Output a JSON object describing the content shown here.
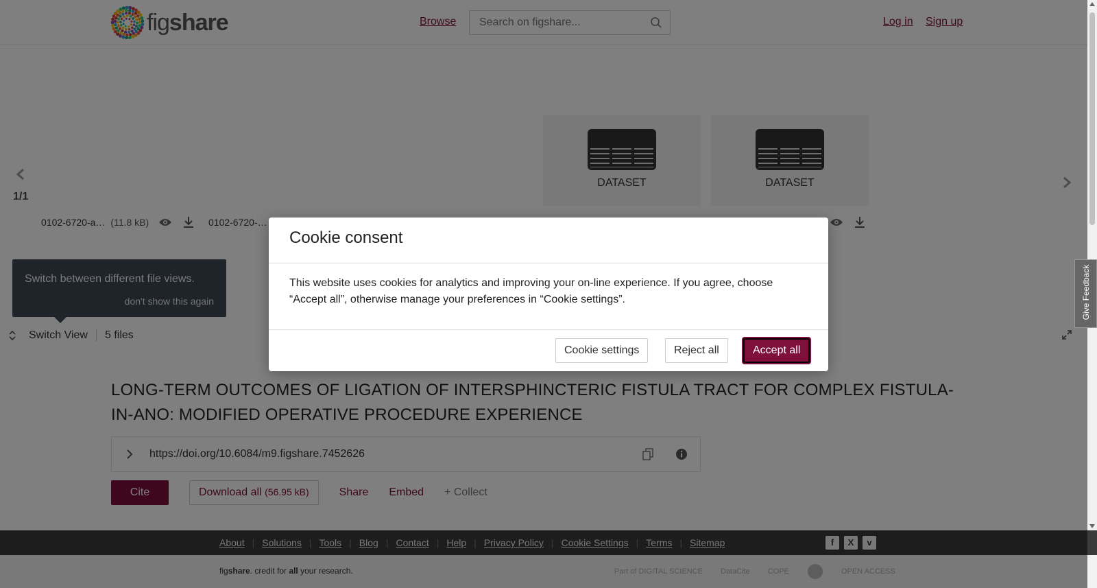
{
  "header": {
    "logo_text_light": "fig",
    "logo_text_bold": "share",
    "browse_label": "Browse",
    "search_placeholder": "Search on figshare...",
    "login_label": "Log in",
    "signup_label": "Sign up"
  },
  "viewer": {
    "pager": "1/1",
    "tiles": [
      {
        "type": "DATASET"
      },
      {
        "type": "DATASET"
      }
    ],
    "files": [
      {
        "name": "0102-6720-a…",
        "size": "(11.8 kB)"
      },
      {
        "name": "0102-6720-…",
        "size": ""
      }
    ],
    "tooltip": {
      "message": "Switch between different file views.",
      "dismiss": "don't show this again"
    },
    "switch_view_label": "Switch View",
    "file_count": "5 files"
  },
  "article": {
    "title": "LONG-TERM OUTCOMES OF LIGATION OF INTERSPHINCTERIC FISTULA TRACT FOR COMPLEX FISTULA-IN-ANO: MODIFIED OPERATIVE PROCEDURE EXPERIENCE",
    "doi": "https://doi.org/10.6084/m9.figshare.7452626",
    "cite_label": "Cite",
    "download_label": "Download all",
    "download_size": "(56.95 kB)",
    "share_label": "Share",
    "embed_label": "Embed",
    "collect_label": "+ Collect"
  },
  "footer": {
    "links": [
      "About",
      "Solutions",
      "Tools",
      "Blog",
      "Contact",
      "Help",
      "Privacy Policy",
      "Cookie Settings",
      "Terms",
      "Sitemap"
    ],
    "social": [
      "f",
      "X",
      "v"
    ],
    "credit_pre": "fig",
    "credit_bold": "share",
    "credit_mid": ". credit for ",
    "credit_all": "all",
    "credit_post": " your research.",
    "partners": [
      "Part of DIGITAL SCIENCE",
      "DataCite",
      "COPE",
      "",
      "OPEN ACCESS"
    ]
  },
  "cookie_modal": {
    "title": "Cookie consent",
    "body": "This website uses cookies for analytics and improving your on-line experience. If you agree, choose “Accept all”, otherwise manage your preferences in “Cookie settings”.",
    "settings_label": "Cookie settings",
    "reject_label": "Reject all",
    "accept_label": "Accept all"
  },
  "feedback_label": "Give Feedback",
  "colors": {
    "brand": "#7f0f3c",
    "footer": "#3a3a3a"
  }
}
